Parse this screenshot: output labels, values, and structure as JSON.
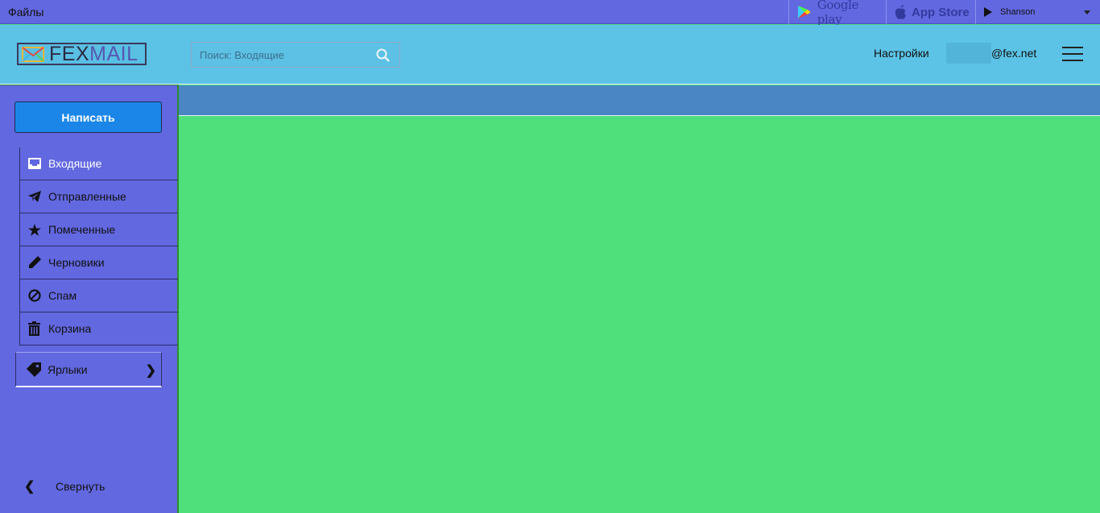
{
  "topbar": {
    "files_label": "Файлы",
    "google_play_label": "Google play",
    "app_store_label": "App Store",
    "player_label": "Shanson"
  },
  "header": {
    "logo_part1": "FEX",
    "logo_part2": "MAIL",
    "search_placeholder": "Поиск: Входящие",
    "settings_label": "Настройки",
    "account_domain": "@fex.net"
  },
  "sidebar": {
    "compose_label": "Написать",
    "folders": [
      {
        "label": "Входящие",
        "icon": "inbox-icon",
        "active": true
      },
      {
        "label": "Отправленные",
        "icon": "paper-plane-icon"
      },
      {
        "label": "Помеченные",
        "icon": "star-icon"
      },
      {
        "label": "Черновики",
        "icon": "pencil-icon"
      },
      {
        "label": "Спам",
        "icon": "ban-icon"
      },
      {
        "label": "Корзина",
        "icon": "trash-icon"
      }
    ],
    "labels_label": "Ярлыки",
    "collapse_label": "Свернуть"
  },
  "colors": {
    "topbar": "#6268e0",
    "header": "#5cc3e6",
    "sidebar": "#6268e0",
    "compose": "#1b86e8",
    "toolbar": "#4a86c4",
    "content": "#4fe07c"
  }
}
